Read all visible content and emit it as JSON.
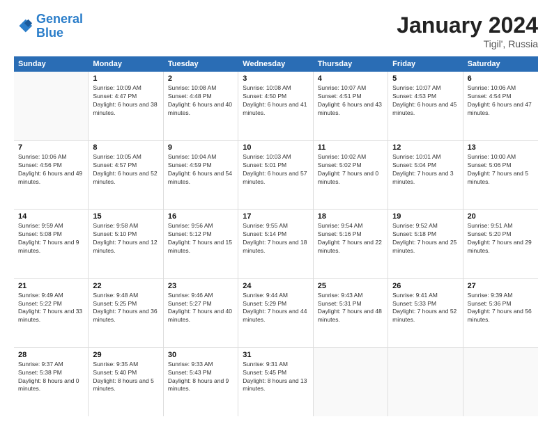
{
  "header": {
    "logo_line1": "General",
    "logo_line2": "Blue",
    "title": "January 2024",
    "subtitle": "Tigil', Russia"
  },
  "calendar": {
    "weekdays": [
      "Sunday",
      "Monday",
      "Tuesday",
      "Wednesday",
      "Thursday",
      "Friday",
      "Saturday"
    ],
    "rows": [
      [
        {
          "day": "",
          "sunrise": "",
          "sunset": "",
          "daylight": "",
          "empty": true
        },
        {
          "day": "1",
          "sunrise": "10:09 AM",
          "sunset": "4:47 PM",
          "daylight": "6 hours and 38 minutes."
        },
        {
          "day": "2",
          "sunrise": "10:08 AM",
          "sunset": "4:48 PM",
          "daylight": "6 hours and 40 minutes."
        },
        {
          "day": "3",
          "sunrise": "10:08 AM",
          "sunset": "4:50 PM",
          "daylight": "6 hours and 41 minutes."
        },
        {
          "day": "4",
          "sunrise": "10:07 AM",
          "sunset": "4:51 PM",
          "daylight": "6 hours and 43 minutes."
        },
        {
          "day": "5",
          "sunrise": "10:07 AM",
          "sunset": "4:53 PM",
          "daylight": "6 hours and 45 minutes."
        },
        {
          "day": "6",
          "sunrise": "10:06 AM",
          "sunset": "4:54 PM",
          "daylight": "6 hours and 47 minutes."
        }
      ],
      [
        {
          "day": "7",
          "sunrise": "10:06 AM",
          "sunset": "4:56 PM",
          "daylight": "6 hours and 49 minutes."
        },
        {
          "day": "8",
          "sunrise": "10:05 AM",
          "sunset": "4:57 PM",
          "daylight": "6 hours and 52 minutes."
        },
        {
          "day": "9",
          "sunrise": "10:04 AM",
          "sunset": "4:59 PM",
          "daylight": "6 hours and 54 minutes."
        },
        {
          "day": "10",
          "sunrise": "10:03 AM",
          "sunset": "5:01 PM",
          "daylight": "6 hours and 57 minutes."
        },
        {
          "day": "11",
          "sunrise": "10:02 AM",
          "sunset": "5:02 PM",
          "daylight": "7 hours and 0 minutes."
        },
        {
          "day": "12",
          "sunrise": "10:01 AM",
          "sunset": "5:04 PM",
          "daylight": "7 hours and 3 minutes."
        },
        {
          "day": "13",
          "sunrise": "10:00 AM",
          "sunset": "5:06 PM",
          "daylight": "7 hours and 5 minutes."
        }
      ],
      [
        {
          "day": "14",
          "sunrise": "9:59 AM",
          "sunset": "5:08 PM",
          "daylight": "7 hours and 9 minutes."
        },
        {
          "day": "15",
          "sunrise": "9:58 AM",
          "sunset": "5:10 PM",
          "daylight": "7 hours and 12 minutes."
        },
        {
          "day": "16",
          "sunrise": "9:56 AM",
          "sunset": "5:12 PM",
          "daylight": "7 hours and 15 minutes."
        },
        {
          "day": "17",
          "sunrise": "9:55 AM",
          "sunset": "5:14 PM",
          "daylight": "7 hours and 18 minutes."
        },
        {
          "day": "18",
          "sunrise": "9:54 AM",
          "sunset": "5:16 PM",
          "daylight": "7 hours and 22 minutes."
        },
        {
          "day": "19",
          "sunrise": "9:52 AM",
          "sunset": "5:18 PM",
          "daylight": "7 hours and 25 minutes."
        },
        {
          "day": "20",
          "sunrise": "9:51 AM",
          "sunset": "5:20 PM",
          "daylight": "7 hours and 29 minutes."
        }
      ],
      [
        {
          "day": "21",
          "sunrise": "9:49 AM",
          "sunset": "5:22 PM",
          "daylight": "7 hours and 33 minutes."
        },
        {
          "day": "22",
          "sunrise": "9:48 AM",
          "sunset": "5:25 PM",
          "daylight": "7 hours and 36 minutes."
        },
        {
          "day": "23",
          "sunrise": "9:46 AM",
          "sunset": "5:27 PM",
          "daylight": "7 hours and 40 minutes."
        },
        {
          "day": "24",
          "sunrise": "9:44 AM",
          "sunset": "5:29 PM",
          "daylight": "7 hours and 44 minutes."
        },
        {
          "day": "25",
          "sunrise": "9:43 AM",
          "sunset": "5:31 PM",
          "daylight": "7 hours and 48 minutes."
        },
        {
          "day": "26",
          "sunrise": "9:41 AM",
          "sunset": "5:33 PM",
          "daylight": "7 hours and 52 minutes."
        },
        {
          "day": "27",
          "sunrise": "9:39 AM",
          "sunset": "5:36 PM",
          "daylight": "7 hours and 56 minutes."
        }
      ],
      [
        {
          "day": "28",
          "sunrise": "9:37 AM",
          "sunset": "5:38 PM",
          "daylight": "8 hours and 0 minutes."
        },
        {
          "day": "29",
          "sunrise": "9:35 AM",
          "sunset": "5:40 PM",
          "daylight": "8 hours and 5 minutes."
        },
        {
          "day": "30",
          "sunrise": "9:33 AM",
          "sunset": "5:43 PM",
          "daylight": "8 hours and 9 minutes."
        },
        {
          "day": "31",
          "sunrise": "9:31 AM",
          "sunset": "5:45 PM",
          "daylight": "8 hours and 13 minutes."
        },
        {
          "day": "",
          "sunrise": "",
          "sunset": "",
          "daylight": "",
          "empty": true
        },
        {
          "day": "",
          "sunrise": "",
          "sunset": "",
          "daylight": "",
          "empty": true
        },
        {
          "day": "",
          "sunrise": "",
          "sunset": "",
          "daylight": "",
          "empty": true
        }
      ]
    ]
  }
}
